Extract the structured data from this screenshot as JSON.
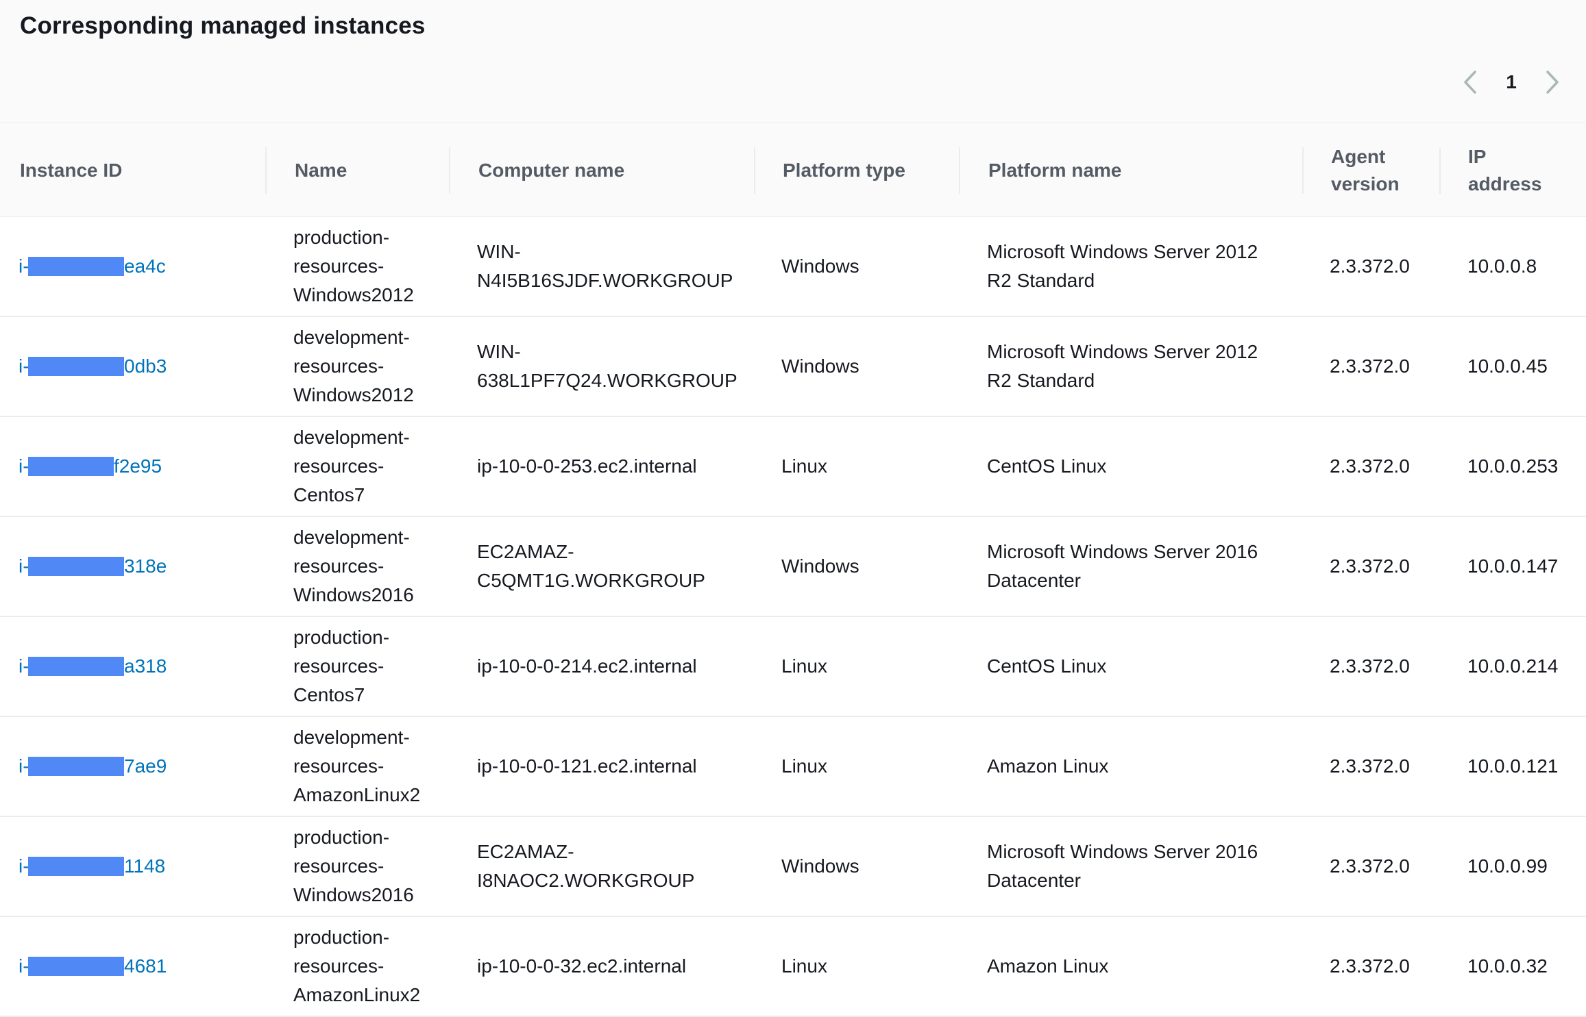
{
  "panel": {
    "title": "Corresponding managed instances",
    "pagination": {
      "current_page": "1",
      "prev_icon": "chevron-left-icon",
      "next_icon": "chevron-right-icon"
    }
  },
  "table": {
    "columns": [
      "Instance ID",
      "Name",
      "Computer name",
      "Platform type",
      "Platform name",
      "Agent\nversion",
      "IP\naddress"
    ],
    "rows": [
      {
        "instance_id_prefix": "i-",
        "instance_id_suffix": "ea4c",
        "name": [
          "production-",
          "resources-",
          "Windows2012"
        ],
        "computer_name": [
          "WIN-",
          "N4I5B16SJDF.WORKGROUP"
        ],
        "platform_type": "Windows",
        "platform_name": [
          "Microsoft Windows Server 2012",
          "R2 Standard"
        ],
        "agent_version": "2.3.372.0",
        "ip_address": "10.0.0.8"
      },
      {
        "instance_id_prefix": "i-",
        "instance_id_suffix": "0db3",
        "name": [
          "development-",
          "resources-",
          "Windows2012"
        ],
        "computer_name": [
          "WIN-",
          "638L1PF7Q24.WORKGROUP"
        ],
        "platform_type": "Windows",
        "platform_name": [
          "Microsoft Windows Server 2012",
          "R2 Standard"
        ],
        "agent_version": "2.3.372.0",
        "ip_address": "10.0.0.45"
      },
      {
        "instance_id_prefix": "i-",
        "instance_id_suffix": "f2e95",
        "name": [
          "development-",
          "resources-",
          "Centos7"
        ],
        "computer_name": [
          "ip-10-0-0-253.ec2.internal"
        ],
        "platform_type": "Linux",
        "platform_name": [
          "CentOS Linux"
        ],
        "agent_version": "2.3.372.0",
        "ip_address": "10.0.0.253"
      },
      {
        "instance_id_prefix": "i-",
        "instance_id_suffix": "318e",
        "name": [
          "development-",
          "resources-",
          "Windows2016"
        ],
        "computer_name": [
          "EC2AMAZ-",
          "C5QMT1G.WORKGROUP"
        ],
        "platform_type": "Windows",
        "platform_name": [
          "Microsoft Windows Server 2016",
          "Datacenter"
        ],
        "agent_version": "2.3.372.0",
        "ip_address": "10.0.0.147"
      },
      {
        "instance_id_prefix": "i-",
        "instance_id_suffix": "a318",
        "name": [
          "production-",
          "resources-",
          "Centos7"
        ],
        "computer_name": [
          "ip-10-0-0-214.ec2.internal"
        ],
        "platform_type": "Linux",
        "platform_name": [
          "CentOS Linux"
        ],
        "agent_version": "2.3.372.0",
        "ip_address": "10.0.0.214"
      },
      {
        "instance_id_prefix": "i-",
        "instance_id_suffix": "7ae9",
        "name": [
          "development-",
          "resources-",
          "AmazonLinux2"
        ],
        "computer_name": [
          "ip-10-0-0-121.ec2.internal"
        ],
        "platform_type": "Linux",
        "platform_name": [
          "Amazon Linux"
        ],
        "agent_version": "2.3.372.0",
        "ip_address": "10.0.0.121"
      },
      {
        "instance_id_prefix": "i-",
        "instance_id_suffix": "1148",
        "name": [
          "production-",
          "resources-",
          "Windows2016"
        ],
        "computer_name": [
          "EC2AMAZ-",
          "I8NAOC2.WORKGROUP"
        ],
        "platform_type": "Windows",
        "platform_name": [
          "Microsoft Windows Server 2016",
          "Datacenter"
        ],
        "agent_version": "2.3.372.0",
        "ip_address": "10.0.0.99"
      },
      {
        "instance_id_prefix": "i-",
        "instance_id_suffix": "4681",
        "name": [
          "production-",
          "resources-",
          "AmazonLinux2"
        ],
        "computer_name": [
          "ip-10-0-0-32.ec2.internal"
        ],
        "platform_type": "Linux",
        "platform_name": [
          "Amazon Linux"
        ],
        "agent_version": "2.3.372.0",
        "ip_address": "10.0.0.32"
      }
    ]
  },
  "colors": {
    "link": "#0073bb",
    "redaction": "#5089f6",
    "header_bg": "#fafafa",
    "border": "#eaeded"
  }
}
